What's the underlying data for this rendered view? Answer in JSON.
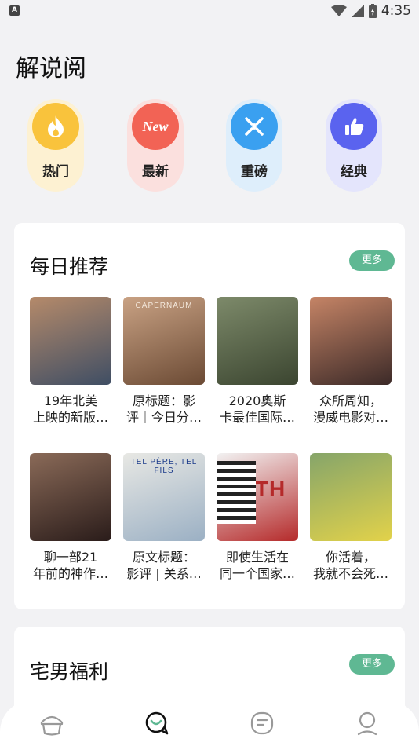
{
  "status": {
    "time": "4:35",
    "notification": "A"
  },
  "page_title": "解说阅",
  "categories": [
    {
      "label": "热门",
      "icon": "flame-icon",
      "bg": "#fdf1d2",
      "circle": "#f9c33c"
    },
    {
      "label": "最新",
      "icon": "new-icon",
      "bg": "#fbe0de",
      "circle": "#f26355",
      "badge": "New"
    },
    {
      "label": "重磅",
      "icon": "burst-icon",
      "bg": "#deeefb",
      "circle": "#3aa0f0"
    },
    {
      "label": "经典",
      "icon": "thumbs-up-icon",
      "bg": "#e4e5fc",
      "circle": "#5a63ef"
    }
  ],
  "daily": {
    "title": "每日推荐",
    "more_label": "更多",
    "items": [
      {
        "caption": "19年北美\n上映的新版…",
        "poster_text": "",
        "colors": [
          "#b58a6a",
          "#3f4e64"
        ]
      },
      {
        "caption": "原标题：影\n评｜今日分…",
        "poster_text": "CAPERNAUM",
        "colors": [
          "#c9a284",
          "#6b4a34"
        ]
      },
      {
        "caption": "2020奥斯\n卡最佳国际…",
        "poster_text": "",
        "colors": [
          "#7d8a6a",
          "#3b4530"
        ]
      },
      {
        "caption": "众所周知，\n漫威电影对…",
        "poster_text": "",
        "colors": [
          "#c58466",
          "#3c2a28"
        ]
      },
      {
        "caption": "聊一部21\n年前的神作…",
        "poster_text": "",
        "colors": [
          "#8a6a58",
          "#2a1c1a"
        ]
      },
      {
        "caption": "原文标题：\n影评 | 关系…",
        "poster_text": "TEL PÈRE, TEL FILS",
        "colors": [
          "#e8e8e4",
          "#9bb0c4"
        ]
      },
      {
        "caption": "即使生活在\n同一个国家…",
        "poster_text": "13TH",
        "colors": [
          "#f2f2f2",
          "#b52a2a"
        ]
      },
      {
        "caption": "你活着，\n我就不会死…",
        "poster_text": "",
        "colors": [
          "#86a56a",
          "#e2d24a"
        ]
      }
    ]
  },
  "otaku": {
    "title": "宅男福利",
    "more_label": "更多"
  },
  "tabs": [
    {
      "name": "tab-home",
      "icon": "home-icon",
      "active": false
    },
    {
      "name": "tab-commentary",
      "icon": "chat-icon",
      "active": true
    },
    {
      "name": "tab-notes",
      "icon": "note-icon",
      "active": false
    },
    {
      "name": "tab-profile",
      "icon": "profile-icon",
      "active": false
    }
  ]
}
